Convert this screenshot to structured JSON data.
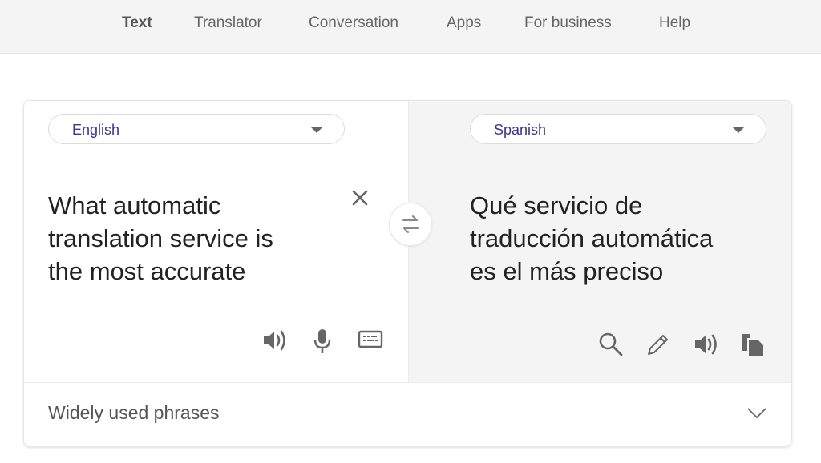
{
  "nav": {
    "items": [
      {
        "label": "Text",
        "active": true
      },
      {
        "label": "Translator",
        "active": false
      },
      {
        "label": "Conversation",
        "active": false
      },
      {
        "label": "Apps",
        "active": false
      },
      {
        "label": "For business",
        "active": false
      },
      {
        "label": "Help",
        "active": false
      }
    ]
  },
  "source": {
    "language": "English",
    "text_lines": [
      "What automatic",
      "translation service is",
      "the most accurate"
    ],
    "icons": [
      "clear-icon",
      "speaker-icon",
      "microphone-icon",
      "keyboard-icon"
    ]
  },
  "target": {
    "language": "Spanish",
    "text_lines": [
      "Qué servicio de",
      "traducción automática",
      "es el más preciso"
    ],
    "icons": [
      "search-icon",
      "pencil-icon",
      "speaker-icon",
      "copy-icon"
    ]
  },
  "swap": {
    "icon": "swap-languages-icon"
  },
  "phrases": {
    "label": "Widely used phrases",
    "icon": "chevron-down-icon"
  },
  "colors": {
    "language_label": "#3b3494",
    "icon": "#666666",
    "right_pane_bg": "#f4f4f4"
  }
}
